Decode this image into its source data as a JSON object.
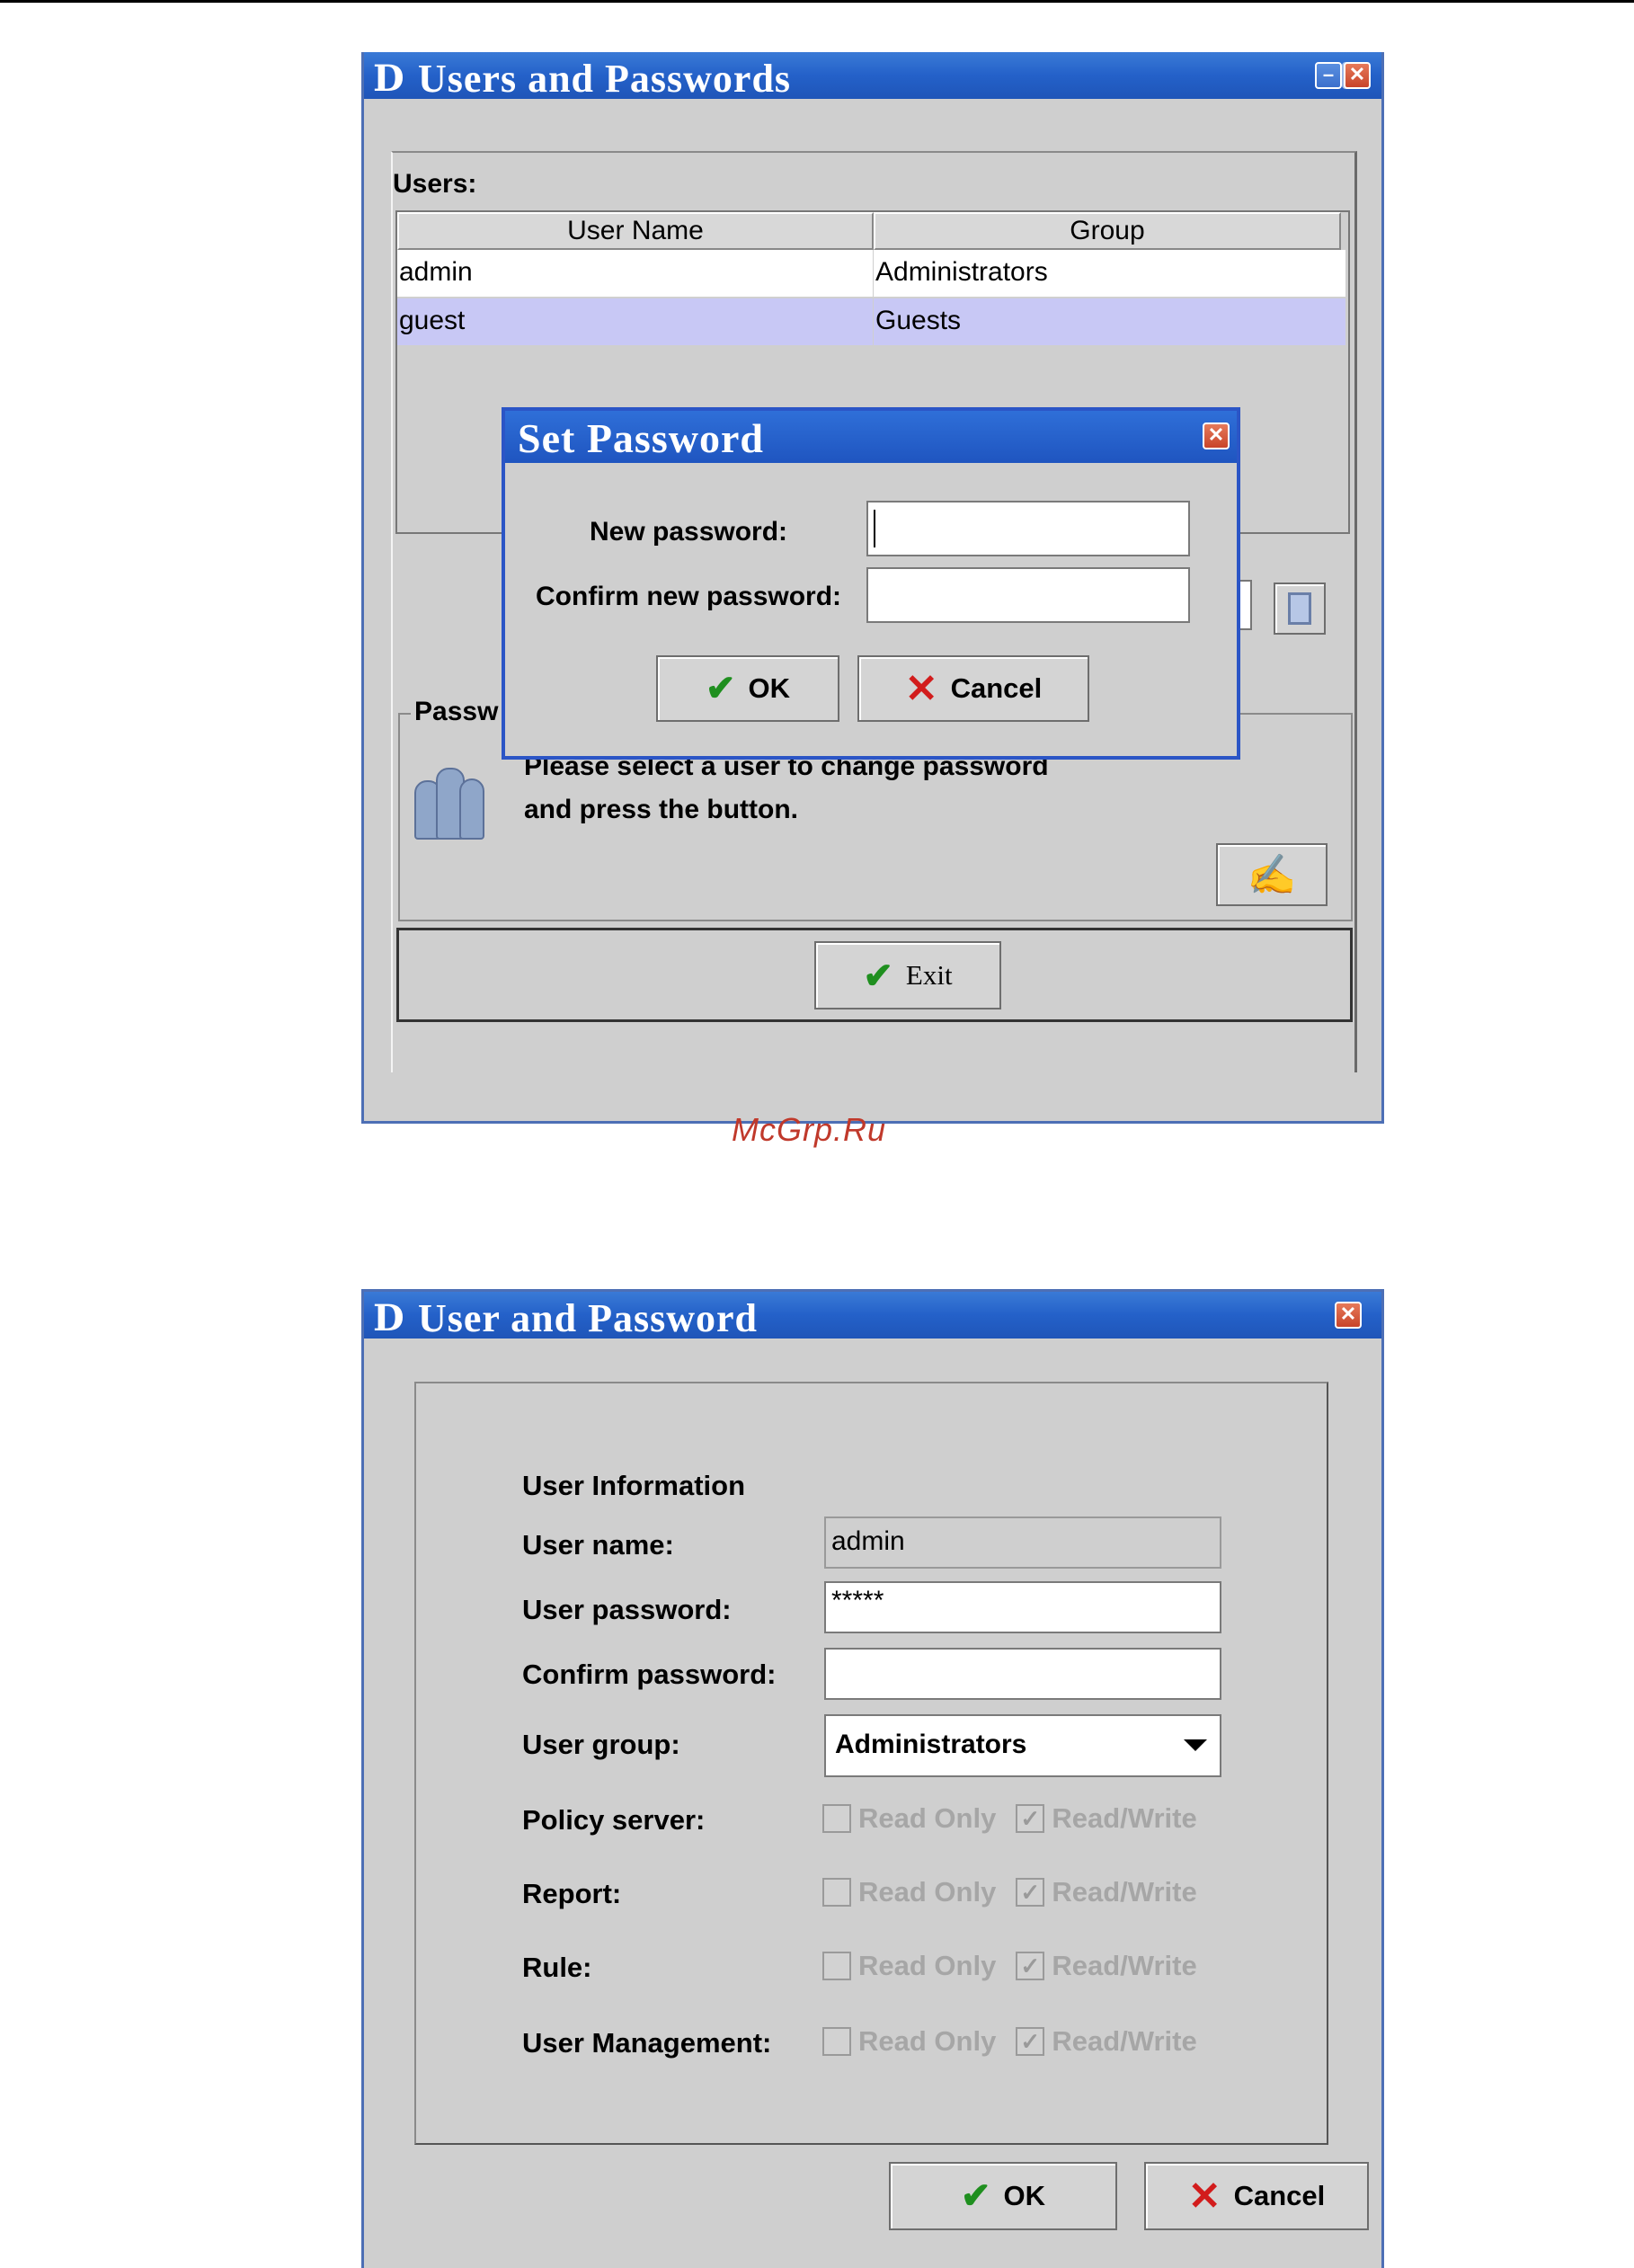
{
  "window1": {
    "logo": "D",
    "title": "Users and Passwords",
    "users_label": "Users:",
    "columns": [
      "User Name",
      "Group"
    ],
    "rows": [
      {
        "name": "admin",
        "group": "Administrators"
      },
      {
        "name": "guest",
        "group": "Guests"
      }
    ],
    "password_group_label": "Passw",
    "info_line1": "Please select a user to change password",
    "info_line2": "and press the button.",
    "exit_label": "Exit"
  },
  "set_password": {
    "title": "Set Password",
    "new_password_label": "New password:",
    "confirm_label": "Confirm new password:",
    "new_password_value": "",
    "confirm_value": "",
    "ok_label": "OK",
    "cancel_label": "Cancel"
  },
  "watermark": "McGrp.Ru",
  "window2": {
    "logo": "D",
    "title": "User and Password",
    "section_label": "User Information",
    "user_name_label": "User name:",
    "user_name_value": "admin",
    "user_password_label": "User password:",
    "user_password_value": "*****",
    "confirm_password_label": "Confirm password:",
    "confirm_password_value": "",
    "user_group_label": "User group:",
    "user_group_value": "Administrators",
    "permissions": [
      {
        "label": "Policy server:",
        "read_only": "Read Only",
        "read_write": "Read/Write",
        "read_write_checked": true
      },
      {
        "label": "Report:",
        "read_only": "Read Only",
        "read_write": "Read/Write",
        "read_write_checked": true
      },
      {
        "label": "Rule:",
        "read_only": "Read Only",
        "read_write": "Read/Write",
        "read_write_checked": true
      },
      {
        "label": "User Management:",
        "read_only": "Read Only",
        "read_write": "Read/Write",
        "read_write_checked": true
      }
    ],
    "ok_label": "OK",
    "cancel_label": "Cancel"
  },
  "colors": {
    "titlebar": "#2461c9",
    "selected_row": "#c8c8f5",
    "watermark": "#c0392b"
  }
}
